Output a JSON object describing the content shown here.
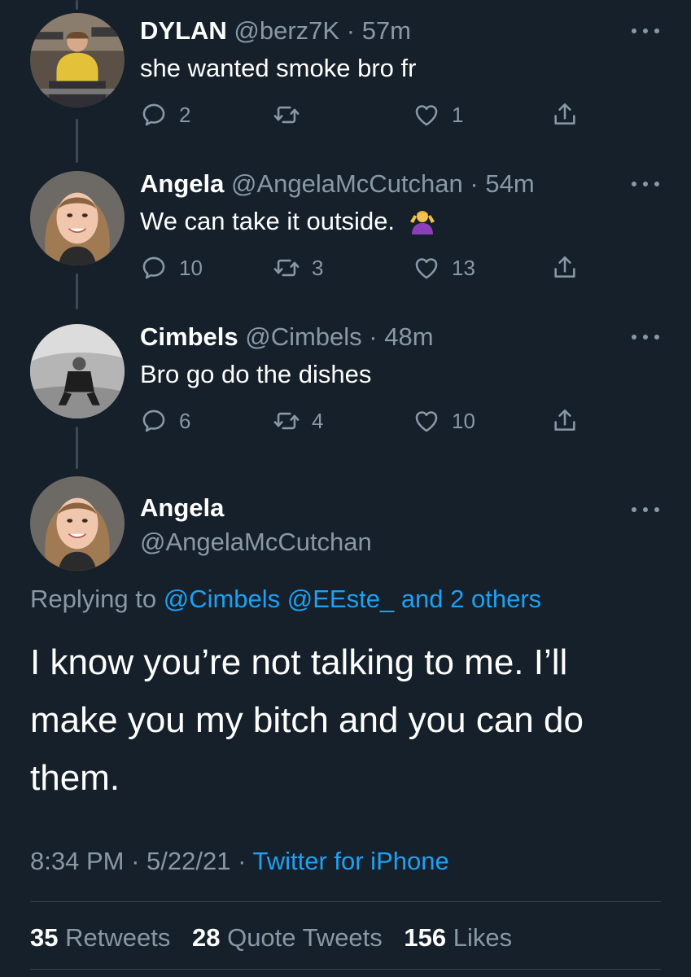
{
  "replies": [
    {
      "name": "DYLAN",
      "handle": "@berz7K",
      "time": "57m",
      "text": "she wanted smoke bro fr",
      "replies": "2",
      "retweets": "",
      "likes": "1",
      "avatar_icon": "avatar-dylan"
    },
    {
      "name": "Angela",
      "handle": "@AngelaMcCutchan",
      "time": "54m",
      "text": "We can take it outside.",
      "emoji_icon": "person-shrugging-emoji-icon",
      "replies": "10",
      "retweets": "3",
      "likes": "13",
      "avatar_icon": "avatar-angela"
    },
    {
      "name": "Cimbels",
      "handle": "@Cimbels",
      "time": "48m",
      "text": "Bro go do the dishes",
      "replies": "6",
      "retweets": "4",
      "likes": "10",
      "avatar_icon": "avatar-cimbels"
    }
  ],
  "main_tweet": {
    "name": "Angela",
    "handle": "@AngelaMcCutchan",
    "replying_prefix": "Replying to",
    "replying_users": "@Cimbels @EEste_",
    "replying_others": "and 2 others",
    "line1": "I know you’re not talking to me. I’ll",
    "line2": "make you my bitch and you can do",
    "line3": "them.",
    "time": "8:34 PM",
    "date": "5/22/21",
    "source": "Twitter for iPhone"
  },
  "stats": {
    "retweets_count": "35",
    "retweets_label": "Retweets",
    "quotes_count": "28",
    "quotes_label": "Quote Tweets",
    "likes_count": "156",
    "likes_label": "Likes"
  },
  "colors": {
    "background": "#15202b",
    "muted": "#8899a6",
    "link": "#1da1f2"
  }
}
